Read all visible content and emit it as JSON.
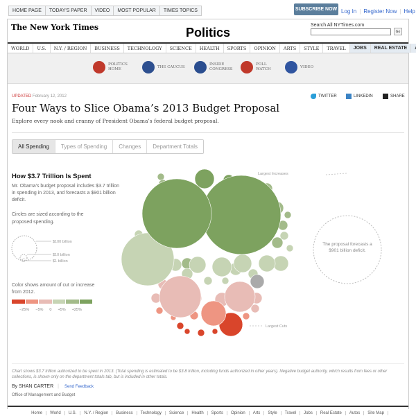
{
  "topnav": [
    "HOME PAGE",
    "TODAY'S PAPER",
    "VIDEO",
    "MOST POPULAR",
    "TIMES TOPICS"
  ],
  "subscribe": "SUBSCRIBE NOW",
  "account": {
    "login": "Log In",
    "register": "Register Now",
    "help": "Help"
  },
  "masthead": {
    "logo": "The New York Times",
    "section": "Politics",
    "search_label": "Search All NYTimes.com",
    "search_value": "",
    "go": "Go"
  },
  "sections": [
    "WORLD",
    "U.S.",
    "N.Y. / REGION",
    "BUSINESS",
    "TECHNOLOGY",
    "SCIENCE",
    "HEALTH",
    "SPORTS",
    "OPINION",
    "ARTS",
    "STYLE",
    "TRAVEL"
  ],
  "sections_bold": [
    "JOBS",
    "REAL ESTATE",
    "AUTOS"
  ],
  "subnav": [
    {
      "l1": "POLITICS",
      "l2": "HOME",
      "color": "#c0392b"
    },
    {
      "l1": "THE CAUCUS",
      "l2": "",
      "color": "#2d4f8f"
    },
    {
      "l1": "INSIDE",
      "l2": "CONGRESS",
      "color": "#2a4d8f"
    },
    {
      "l1": "POLL",
      "l2": "WATCH",
      "color": "#c0392b"
    },
    {
      "l1": "VIDEO",
      "l2": "",
      "color": "#3055a0"
    }
  ],
  "article": {
    "updated_label": "UPDATED",
    "date": "February 12, 2012",
    "title": "Four Ways to Slice Obama’s 2013 Budget Proposal",
    "dek": "Explore every nook and cranny of President Obama’s federal budget proposal."
  },
  "share": {
    "twitter": "TWITTER",
    "linkedin": "LINKEDIN",
    "share": "SHARE"
  },
  "tabs": [
    "All Spending",
    "Types of Spending",
    "Changes",
    "Department Totals"
  ],
  "active_tab": "All Spending",
  "sidebar": {
    "heading": "How $3.7 Trillion Is Spent",
    "intro": "Mr. Obama's budget proposal includes $3.7 trillion in spending in 2013, and forecasts a $901 billion deficit.",
    "size_note": "Circles are sized according to the proposed spending.",
    "size_labels": [
      "$100 billion",
      "$10 billion",
      "$1 billion"
    ],
    "color_note": "Color shows amount of cut or increase from 2012.",
    "color_scale": [
      "#d9452b",
      "#ee9582",
      "#e8bcb6",
      "#c6d4b4",
      "#a3bb8a",
      "#7da25f"
    ],
    "color_ticks": [
      "−25%",
      "−5%",
      "0",
      "+5%",
      "+25%"
    ]
  },
  "chart": {
    "label_increases": "Largest Increases",
    "label_cuts": "Largest Cuts",
    "deficit_note": "The proposal forecasts a $901 billion deficit."
  },
  "footnote": "Chart shows $3.7 trillion authorized to be spent in 2013. (Total spending is estimated to be $3.8 trillion, including funds authorized in other years). Negative budget authority, which results from fees or other collections, is shown only on the department totals tab, but is included in other totals.",
  "byline": "By SHAN CARTER",
  "feedback": "Send Feedback",
  "source": "Office of Management and Budget",
  "footer_nav": [
    "Home",
    "World",
    "U.S.",
    "N.Y. / Region",
    "Business",
    "Technology",
    "Science",
    "Health",
    "Sports",
    "Opinion",
    "Arts",
    "Style",
    "Travel",
    "Jobs",
    "Real Estate",
    "Autos",
    "Site Map"
  ]
}
